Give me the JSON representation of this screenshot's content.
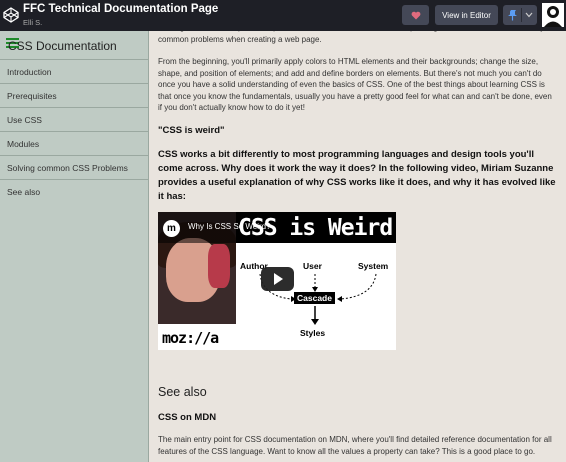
{
  "header": {
    "title": "FFC Technical Documentation Page",
    "author": "Elli S.",
    "view_button": "View in Editor"
  },
  "sidebar": {
    "title": "CSS Documentation",
    "items": [
      {
        "label": "Introduction"
      },
      {
        "label": "Prerequisites"
      },
      {
        "label": "Use CSS"
      },
      {
        "label": "Modules"
      },
      {
        "label": "Solving common CSS Problems"
      },
      {
        "label": "See also"
      }
    ]
  },
  "main": {
    "para_top": "Solving common CSS problems provides links to sections of content explaining how to use CSS to solve very common problems when creating a web page.",
    "para_1": "From the beginning, you'll primarily apply colors to HTML elements and their backgrounds; change the size, shape, and position of elements; and add and define borders on elements. But there's not much you can't do once you have a solid understanding of even the basics of CSS. One of the best things about learning CSS is that once you know the fundamentals, usually you have a pretty good feel for what can and can't be done, even if you don't actually know how to do it yet!",
    "weird_heading": "\"CSS is weird\"",
    "weird_para": "CSS works a bit differently to most programming languages and design tools you'll come across. Why does it work the way it does? In the following video, Miriam Suzanne provides a useful explanation of why CSS works like it does, and why it has evolved like it has:",
    "video": {
      "channel_initial": "m",
      "title": "Why Is CSS So Weird?",
      "big_title": "CSS is Weird",
      "logo_text": "moz://a",
      "diagram": {
        "author": "Author",
        "user": "User",
        "system": "System",
        "cascade": "Cascade",
        "styles": "Styles"
      }
    },
    "see_also_heading": "See also",
    "mdn_heading": "CSS on MDN",
    "mdn_para": "The main entry point for CSS documentation on MDN, where you'll find detailed reference documentation for all features of the CSS language. Want to know all the values a property can take? This is a good place to go."
  }
}
